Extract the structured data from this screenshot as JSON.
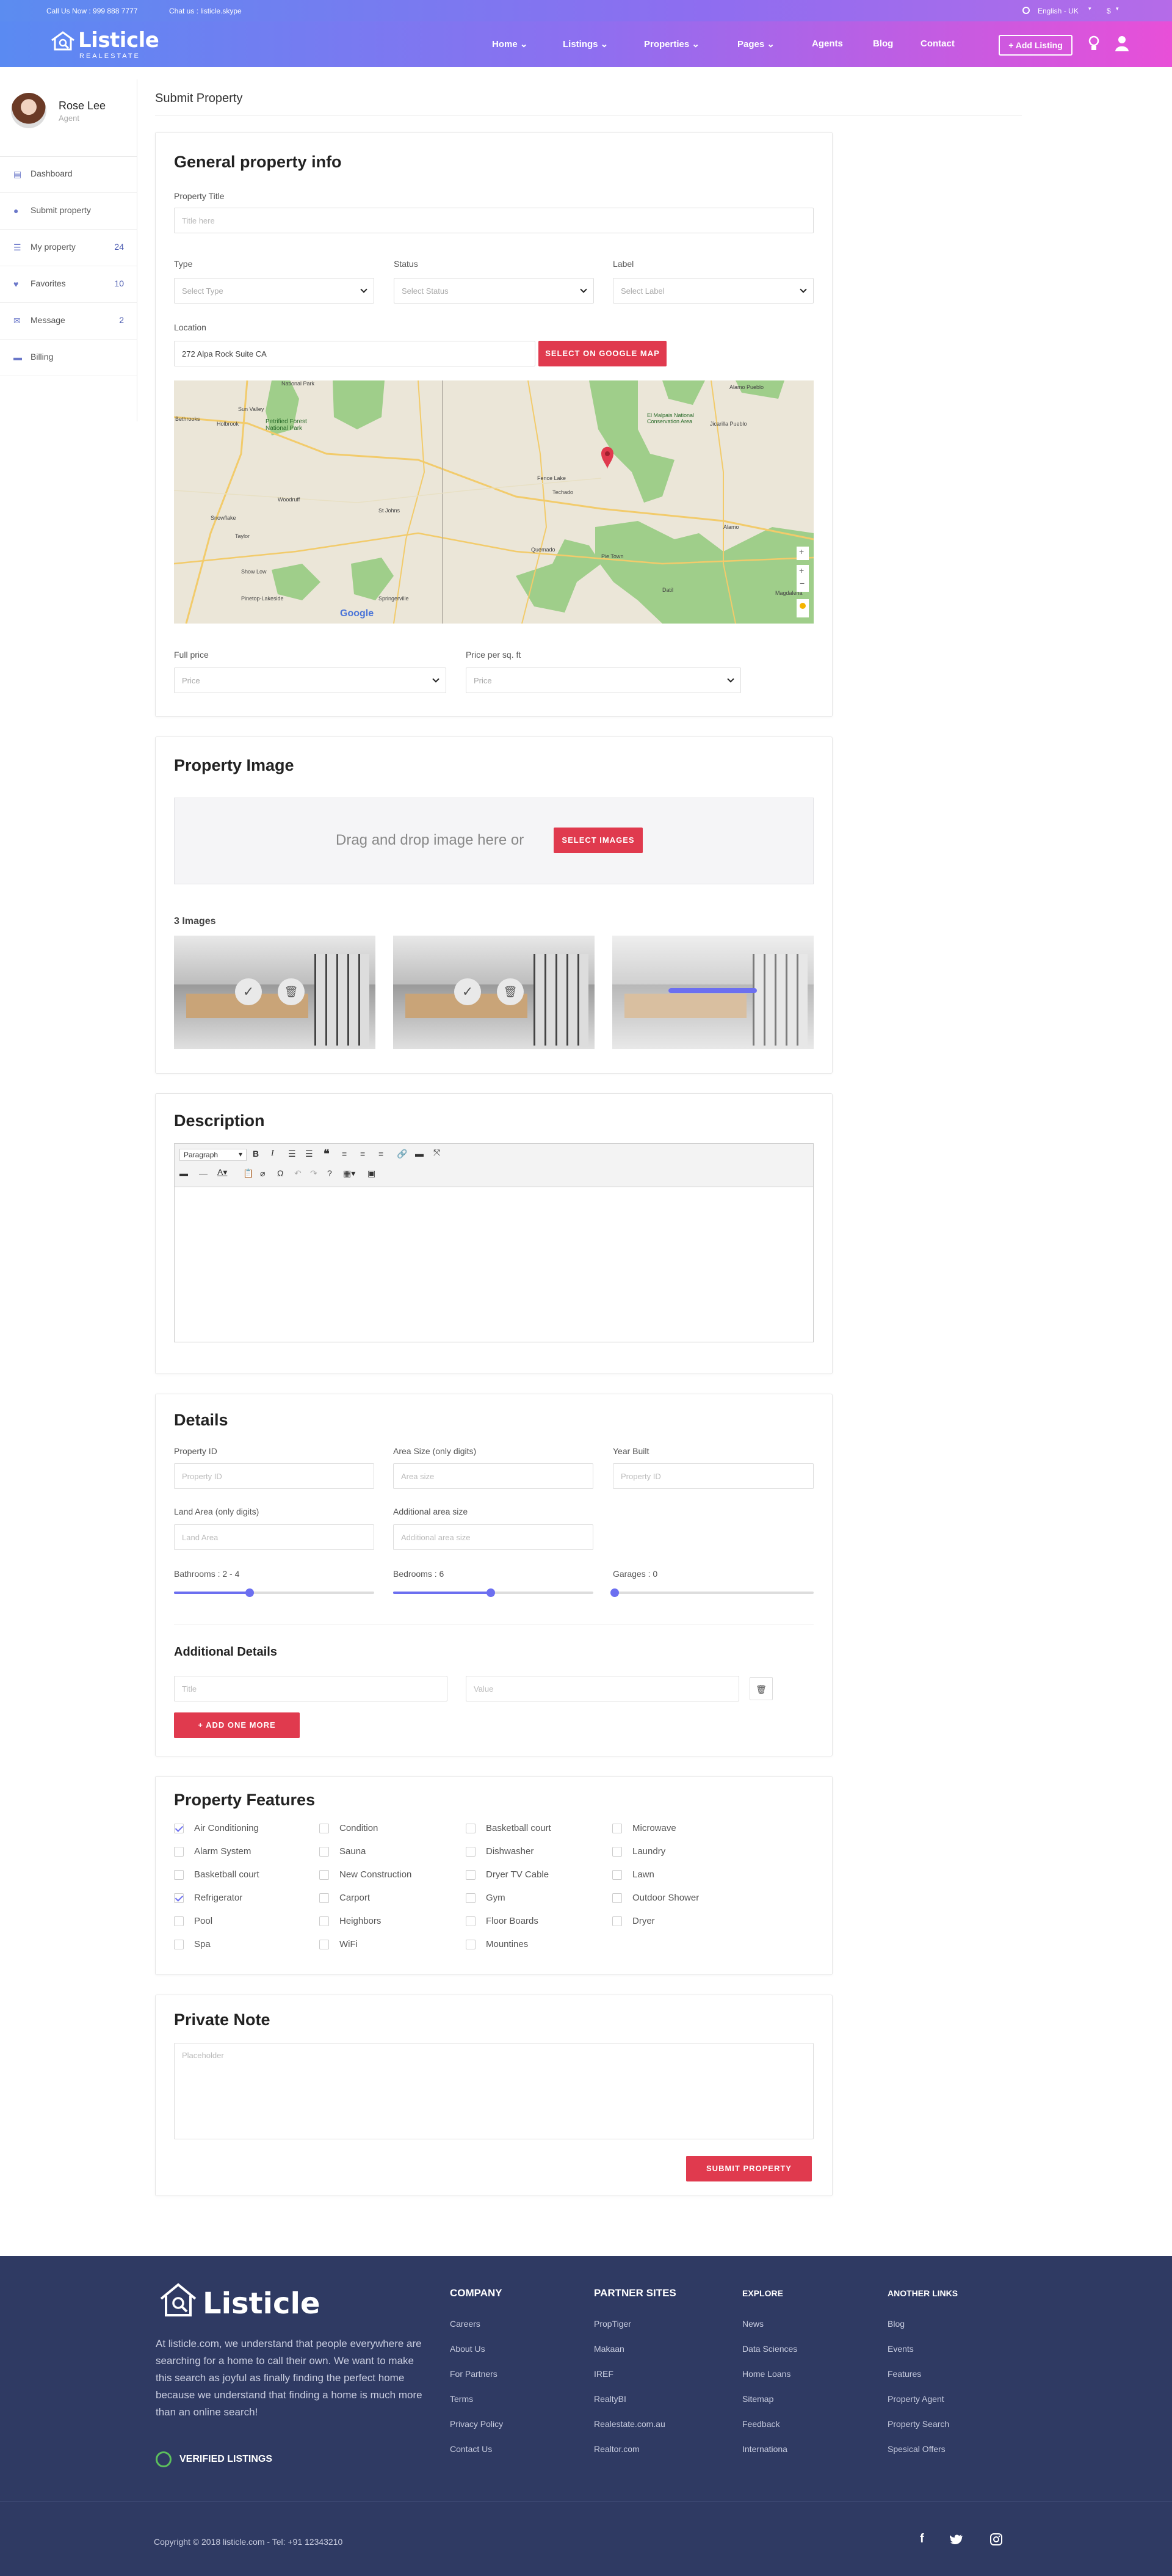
{
  "topbar": {
    "call": "Call Us Now : 999 888 7777",
    "chat": "Chat us : listicle.skype",
    "language": "English - UK",
    "currency": "$"
  },
  "header": {
    "brand": "Listicle",
    "brand_sub": "REALESTATE",
    "nav": [
      "Home",
      "Listings",
      "Properties",
      "Pages",
      "Agents",
      "Blog",
      "Contact"
    ],
    "add_listing": "+ Add Listing"
  },
  "user": {
    "name": "Rose Lee",
    "role": "Agent"
  },
  "sidebar": {
    "items": [
      {
        "label": "Dashboard",
        "count": ""
      },
      {
        "label": "Submit property",
        "count": ""
      },
      {
        "label": "My property",
        "count": "24"
      },
      {
        "label": "Favorites",
        "count": "10"
      },
      {
        "label": "Message",
        "count": "2"
      },
      {
        "label": "Billing",
        "count": ""
      }
    ]
  },
  "page_title": "Submit Property",
  "general": {
    "heading": "General property info",
    "title_label": "Property Title",
    "title_placeholder": "Title here",
    "type_label": "Type",
    "type_value": "Select Type",
    "status_label": "Status",
    "status_value": "Select Status",
    "label_label": "Label",
    "label_value": "Select Label",
    "location_label": "Location",
    "location_value": "272 Alpa Rock Suite CA",
    "map_button": "SELECT ON GOOGLE MAP",
    "map_labels": [
      "National Park",
      "Holbrook",
      "Sun Valley",
      "Petrified Forest National Park",
      "Woodruff",
      "Snowflake",
      "Taylor",
      "Show Low",
      "Pinetop-Lakeside",
      "St Johns",
      "Springerville",
      "Fence Lake",
      "Quemado",
      "Pie Town",
      "Datil",
      "Magdalena",
      "Alamo",
      "El Malpais National Conservation Area",
      "Jicarilla Pueblo",
      "Techado",
      "Bethrooks",
      "Alamo Pueblo",
      "Google"
    ],
    "full_price_label": "Full price",
    "full_price_value": "Price",
    "sqft_label": "Price per sq. ft",
    "sqft_value": "Price"
  },
  "image": {
    "heading": "Property Image",
    "drop_text": "Drag and drop image here or",
    "select_button": "SELECT IMAGES",
    "count_label": "3 Images"
  },
  "description": {
    "heading": "Description",
    "format": "Paragraph"
  },
  "details": {
    "heading": "Details",
    "id_label": "Property ID",
    "id_placeholder": "Property ID",
    "area_label": "Area Size (only digits)",
    "area_placeholder": "Area size",
    "year_label": "Year Built",
    "year_placeholder": "Property ID",
    "land_label": "Land Area (only digits)",
    "land_placeholder": "Land Area",
    "addarea_label": "Additional area size",
    "addarea_placeholder": "Additional area size",
    "bath_label": "Bathrooms : 2 - 4",
    "bed_label": "Bedrooms : 6",
    "garage_label": "Garages : 0",
    "bath_level": 0.37,
    "bed_level": 0.48,
    "garage_level": 0.0,
    "add_heading": "Additional Details",
    "add_title_placeholder": "Title",
    "add_value_placeholder": "Value",
    "add_more": "+ ADD ONE MORE"
  },
  "features": {
    "heading": "Property Features",
    "columns": [
      [
        {
          "label": "Air Conditioning",
          "checked": true
        },
        {
          "label": "Alarm System",
          "checked": false
        },
        {
          "label": "Basketball court",
          "checked": false
        },
        {
          "label": "Refrigerator",
          "checked": true
        },
        {
          "label": "Pool",
          "checked": false
        },
        {
          "label": "Spa",
          "checked": false
        }
      ],
      [
        {
          "label": "Condition",
          "checked": false
        },
        {
          "label": "Sauna",
          "checked": false
        },
        {
          "label": "New Construction",
          "checked": false
        },
        {
          "label": "Carport",
          "checked": false
        },
        {
          "label": "Heighbors",
          "checked": false
        },
        {
          "label": "WiFi",
          "checked": false
        }
      ],
      [
        {
          "label": "Basketball court",
          "checked": false
        },
        {
          "label": "Dishwasher",
          "checked": false
        },
        {
          "label": "Dryer TV Cable",
          "checked": false
        },
        {
          "label": "Gym",
          "checked": false
        },
        {
          "label": "Floor Boards",
          "checked": false
        },
        {
          "label": "Mountines",
          "checked": false
        }
      ],
      [
        {
          "label": "Microwave",
          "checked": false
        },
        {
          "label": "Laundry",
          "checked": false
        },
        {
          "label": "Lawn",
          "checked": false
        },
        {
          "label": "Outdoor Shower",
          "checked": false
        },
        {
          "label": "Dryer",
          "checked": false
        }
      ]
    ]
  },
  "note": {
    "heading": "Private Note",
    "placeholder": "Placeholder",
    "submit": "SUBMIT PROPERTY"
  },
  "footer": {
    "brand": "Listicle",
    "about": "At listicle.com, we understand that people everywhere are searching for a home to call their own. We want to make this search as joyful as finally finding the perfect home because we understand that finding a home is much more than an online search!",
    "verified": "VERIFIED LISTINGS",
    "company": {
      "heading": "COMPANY",
      "links": [
        "Careers",
        "About Us",
        "For Partners",
        "Terms",
        "Privacy Policy",
        "Contact Us"
      ]
    },
    "partners": {
      "heading": "PARTNER SITES",
      "links": [
        "PropTiger",
        "Makaan",
        "IREF",
        "RealtyBI",
        "Realestate.com.au",
        "Realtor.com"
      ]
    },
    "explore": {
      "heading": "EXPLORE",
      "links": [
        "News",
        "Data Sciences",
        "Home Loans",
        "Sitemap",
        "Feedback",
        "Internationa"
      ]
    },
    "another": {
      "heading": "ANOTHER LINKS",
      "links": [
        "Blog",
        "Events",
        "Features",
        "Property Agent",
        "Property Search",
        "Spesical Offers"
      ]
    },
    "copyright": "Copyright © 2018 listicle.com - Tel: +91 12343210"
  },
  "colors": {
    "accent": "#6c6ff0",
    "red": "#e03a4e",
    "footer": "#2f3a63"
  }
}
